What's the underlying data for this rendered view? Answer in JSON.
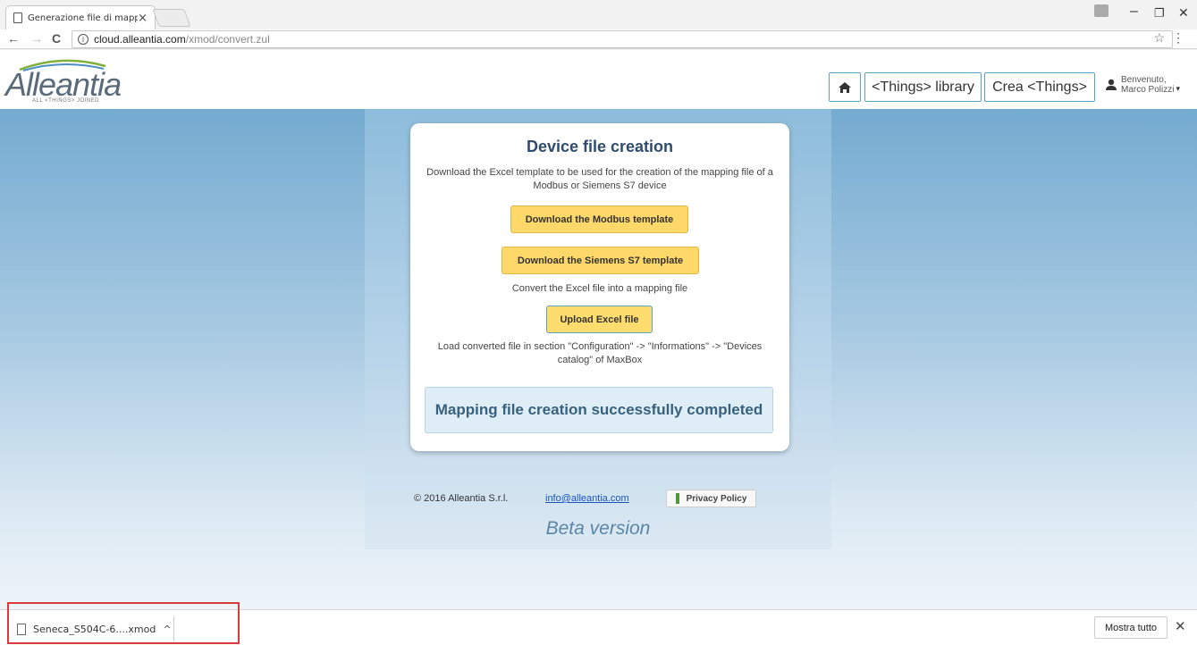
{
  "browser": {
    "tab_title": "Generazione file di mapp",
    "tab_close": "×",
    "url_host": "cloud.alleantia.com",
    "url_path": "/xmod/convert.zul",
    "nav_back": "←",
    "nav_forward": "→",
    "nav_reload": "C",
    "info": "i",
    "star": "☆",
    "menu": "⋮",
    "win_min": "–",
    "win_max": "❐",
    "win_close": "✕"
  },
  "header": {
    "logo_word": "Alleantia",
    "logo_tag": "ALL <THINGS> JOINED",
    "home_icon": "home-icon",
    "library_label": "<Things> library",
    "create_label": "Crea <Things>",
    "user_greeting": "Benvenuto,",
    "user_name": "Marco Polizzi",
    "user_caret": "▾"
  },
  "card": {
    "title": "Device file creation",
    "intro": "Download the Excel template to be used for the creation of the mapping file of a Modbus or Siemens S7 device",
    "modbus_button": "Download the Modbus template",
    "siemens_button": "Download the Siemens S7 template",
    "convert_text": "Convert the Excel file into a mapping file",
    "upload_button": "Upload Excel file",
    "load_text": "Load converted file in section \"Configuration\" -> \"Informations\" -> \"Devices catalog\" of MaxBox",
    "success_message": "Mapping file creation successfully completed"
  },
  "footer": {
    "copyright": "© 2016 Alleantia S.r.l.",
    "email": "info@alleantia.com",
    "privacy": "Privacy Policy",
    "beta": "Beta version"
  },
  "downloads": {
    "file_name": "Seneca_S504C-6....xmod",
    "chevron": "^",
    "show_all": "Mostra tutto",
    "close": "✕"
  },
  "colors": {
    "accent_border": "#5aa3c6",
    "button_yellow": "#ffd86a",
    "title_blue": "#2f4b6e",
    "highlight_red": "#d93a3a"
  }
}
